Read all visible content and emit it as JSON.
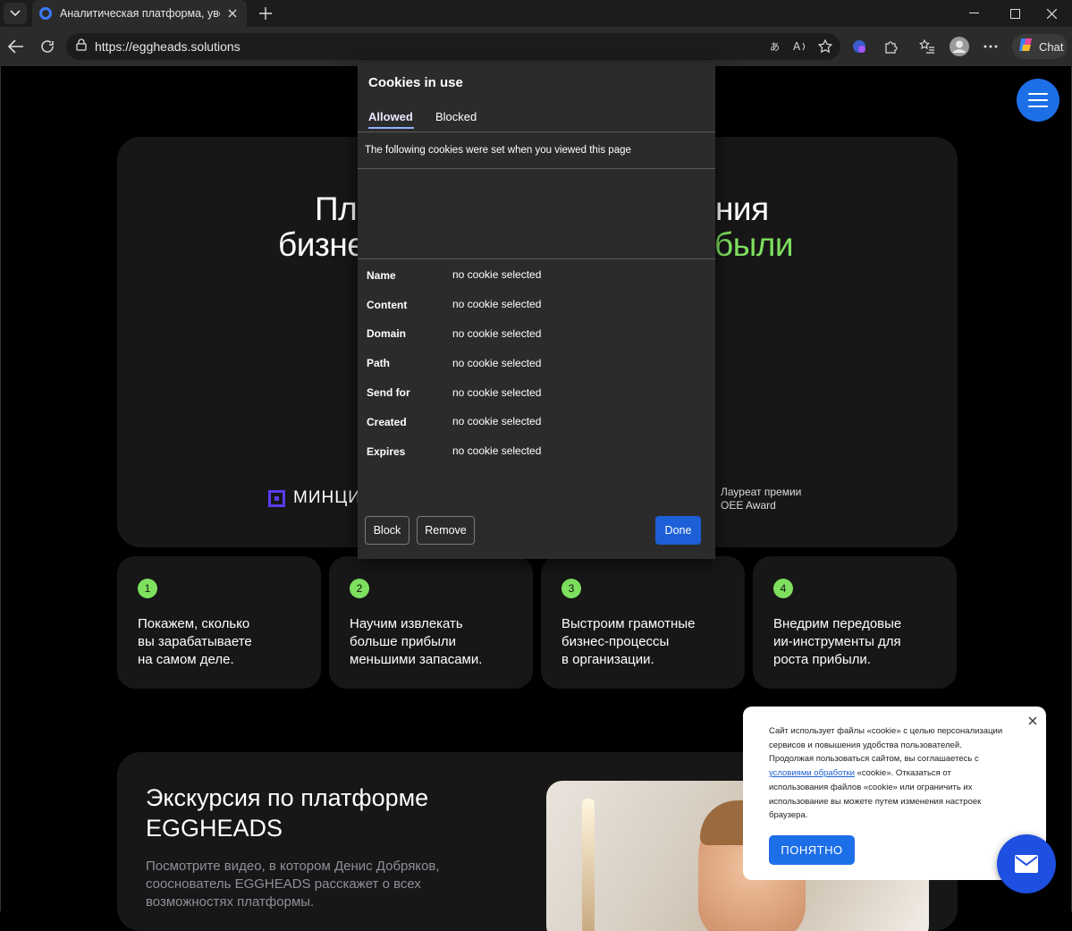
{
  "browser": {
    "tab_title": "Аналитическая платформа, увели",
    "url": "https://eggheads.solutions",
    "chat_label": "Chat"
  },
  "hero": {
    "line1_left": "Пл",
    "line1_right": "ния",
    "line2_left": "бизне",
    "line2_right": "были",
    "partner_logo": "МИНЦИ",
    "award": [
      "Лауреат премии",
      "OEE Award"
    ]
  },
  "steps": [
    {
      "num": "1",
      "text": [
        "Покажем, сколько",
        "вы зарабатываете",
        "на самом деле."
      ]
    },
    {
      "num": "2",
      "text": [
        "Научим извлекать",
        "больше прибыли",
        "меньшими запасами."
      ]
    },
    {
      "num": "3",
      "text": [
        "Выстроим грамотные",
        "бизнес-процессы",
        "в организации."
      ]
    },
    {
      "num": "4",
      "text": [
        "Внедрим передовые",
        "ии-инструменты для",
        "роста прибыли."
      ]
    }
  ],
  "tour": {
    "title": [
      "Экскурсия по платформе",
      "EGGHEADS"
    ],
    "desc": [
      "Посмотрите видео, в котором Денис Добряков,",
      "сооснователь EGGHEADS расскажет о всех",
      "возможностях платформы."
    ]
  },
  "cookie_dialog": {
    "title": "Cookies in use",
    "tab_allowed": "Allowed",
    "tab_blocked": "Blocked",
    "info": "The following cookies were set when you viewed this page",
    "fields": [
      {
        "label": "Name",
        "value": "no cookie selected"
      },
      {
        "label": "Content",
        "value": "no cookie selected"
      },
      {
        "label": "Domain",
        "value": "no cookie selected"
      },
      {
        "label": "Path",
        "value": "no cookie selected"
      },
      {
        "label": "Send for",
        "value": "no cookie selected"
      },
      {
        "label": "Created",
        "value": "no cookie selected"
      },
      {
        "label": "Expires",
        "value": "no cookie selected"
      }
    ],
    "btn_block": "Block",
    "btn_remove": "Remove",
    "btn_done": "Done"
  },
  "consent": {
    "lines": [
      "Сайт использует файлы «cookie» с целью персонализации",
      "сервисов и повышения удобства пользователей.",
      "Продолжая пользоваться сайтом, вы соглашаетесь с"
    ],
    "link": "условиями обработки",
    "after_link": " «cookie». Отказаться от",
    "lines2": [
      "использования файлов «cookie» или ограничить их",
      "использование вы можете путем изменения настроек",
      "браузера."
    ],
    "ok": "ПОНЯТНО"
  },
  "colors": {
    "accent": "#1d6fe8",
    "green": "#7ee05f",
    "dialog_bg": "#2b2b2b"
  }
}
